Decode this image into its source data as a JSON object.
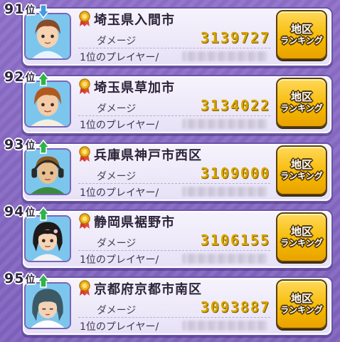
{
  "colors": {
    "background": "#8063bf",
    "damage_value": "#d9a400",
    "button": "#f6b800",
    "rank_up_arrow": "#2fb34a",
    "rank_down_arrow": "#3f9be0"
  },
  "entries": [
    {
      "rank_number": "91",
      "rank_suffix": "位",
      "trend_icon": "arrow-down-icon",
      "city": "埼玉県入間市",
      "damage_label": "ダメージ",
      "damage": "3139727",
      "top_player_label": "1位のプレイヤー/",
      "button_line1": "地区",
      "button_line2": "ランキング"
    },
    {
      "rank_number": "92",
      "rank_suffix": "位",
      "trend_icon": "arrow-up-icon",
      "city": "埼玉県草加市",
      "damage_label": "ダメージ",
      "damage": "3134022",
      "top_player_label": "1位のプレイヤー/",
      "button_line1": "地区",
      "button_line2": "ランキング"
    },
    {
      "rank_number": "93",
      "rank_suffix": "位",
      "trend_icon": "arrow-up-icon",
      "city": "兵庫県神戸市西区",
      "damage_label": "ダメージ",
      "damage": "3109000",
      "top_player_label": "1位のプレイヤー/",
      "button_line1": "地区",
      "button_line2": "ランキング"
    },
    {
      "rank_number": "94",
      "rank_suffix": "位",
      "trend_icon": "arrow-up-icon",
      "city": "静岡県裾野市",
      "damage_label": "ダメージ",
      "damage": "3106155",
      "top_player_label": "1位のプレイヤー/",
      "button_line1": "地区",
      "button_line2": "ランキング"
    },
    {
      "rank_number": "95",
      "rank_suffix": "位",
      "trend_icon": "arrow-up-icon",
      "city": "京都府京都市南区",
      "damage_label": "ダメージ",
      "damage": "3093887",
      "top_player_label": "1位のプレイヤー/",
      "button_line1": "地区",
      "button_line2": "ランキング"
    }
  ]
}
